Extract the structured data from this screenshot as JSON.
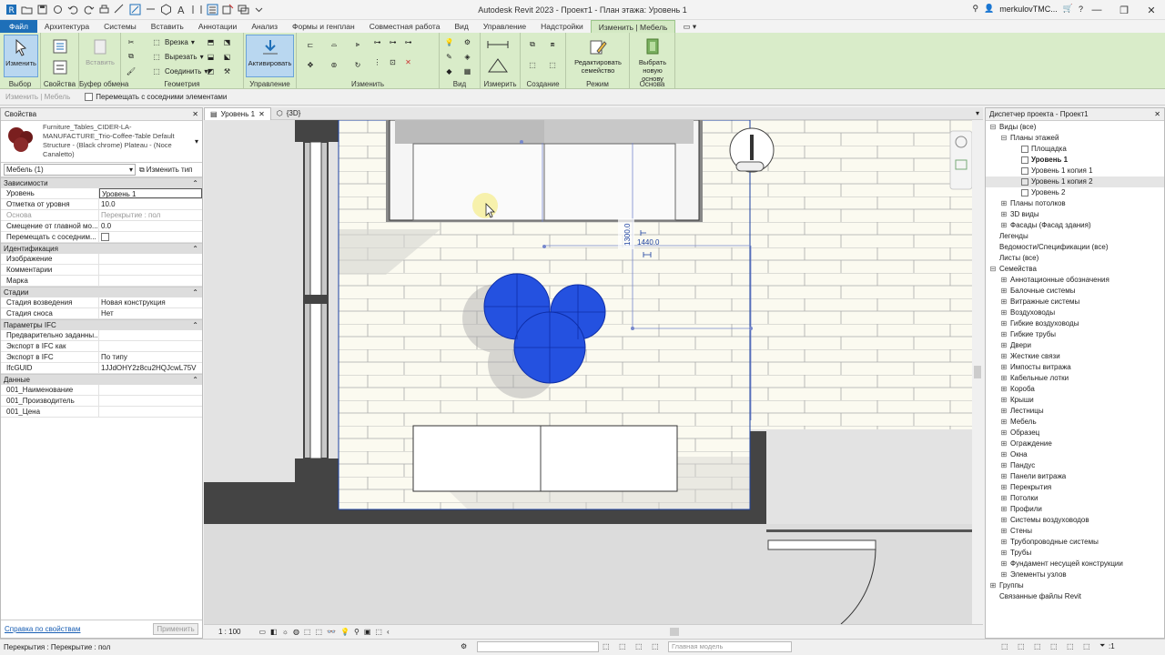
{
  "window": {
    "title": "Autodesk Revit 2023 - Проект1 - План этажа: Уровень 1",
    "user": "merkulovTMC..."
  },
  "ribbon_tabs": [
    "Файл",
    "Архитектура",
    "Системы",
    "Вставить",
    "Аннотации",
    "Анализ",
    "Формы и генплан",
    "Совместная работа",
    "Вид",
    "Управление",
    "Надстройки",
    "Изменить | Мебель"
  ],
  "ribbon": {
    "modify_label": "Изменить",
    "properties_label": "Свойства",
    "paste_label": "Вставить",
    "cut_label": "Врезка",
    "unjoin_label": "Вырезать",
    "join_label": "Соединить",
    "activate_label": "Активировать",
    "edit_family_label": "Редактировать семейство",
    "pick_host_label": "Выбрать новую основу",
    "groups": {
      "select": "Выбор",
      "props": "Свойства",
      "clipboard": "Буфер обмена",
      "geometry": "Геометрия",
      "control": "Управление",
      "modify": "Изменить",
      "view": "Вид",
      "measure": "Измерить",
      "create": "Создание",
      "mode": "Режим",
      "host": "Основа"
    }
  },
  "optbar": {
    "context": "Изменить | Мебель",
    "move_with_nearby": "Перемещать с соседними элементами"
  },
  "properties": {
    "header": "Свойства",
    "type_name": "Furniture_Tables_CIDER-LA-MANUFACTURE_Trio-Coffee-Table Default Structure - (Black chrome) Plateau - (Noce Canaletto)",
    "selector": "Мебель (1)",
    "edit_type": "Изменить тип",
    "sections": [
      {
        "title": "Зависимости",
        "rows": [
          {
            "k": "Уровень",
            "v": "Уровень 1"
          },
          {
            "k": "Отметка от уровня",
            "v": "10.0"
          },
          {
            "k": "Основа",
            "v": "Перекрытие : пол"
          },
          {
            "k": "Смещение от главной мо...",
            "v": "0.0"
          },
          {
            "k": "Перемещать с соседним...",
            "v": ""
          }
        ]
      },
      {
        "title": "Идентификация",
        "rows": [
          {
            "k": "Изображение",
            "v": ""
          },
          {
            "k": "Комментарии",
            "v": ""
          },
          {
            "k": "Марка",
            "v": ""
          }
        ]
      },
      {
        "title": "Стадии",
        "rows": [
          {
            "k": "Стадия возведения",
            "v": "Новая конструкция"
          },
          {
            "k": "Стадия сноса",
            "v": "Нет"
          }
        ]
      },
      {
        "title": "Параметры IFC",
        "rows": [
          {
            "k": "Предварительно заданны...",
            "v": ""
          },
          {
            "k": "Экспорт в IFC как",
            "v": ""
          },
          {
            "k": "Экспорт в IFC",
            "v": "По типу"
          },
          {
            "k": "IfcGUID",
            "v": "1JJdOHY2z8cu2HQJcwL75V"
          }
        ]
      },
      {
        "title": "Данные",
        "rows": [
          {
            "k": "001_Наименование",
            "v": ""
          },
          {
            "k": "001_Производитель",
            "v": ""
          },
          {
            "k": "001_Цена",
            "v": ""
          }
        ]
      }
    ],
    "help_link": "Справка по свойствам",
    "apply": "Применить"
  },
  "view_tabs": [
    {
      "label": "Уровень 1"
    },
    {
      "label": "{3D}"
    }
  ],
  "canvas": {
    "dim_vertical": "1300.0",
    "dim_horizontal": "1440.0"
  },
  "view_control": {
    "scale": "1 : 100"
  },
  "browser": {
    "header": "Диспетчер проекта - Проект1",
    "items": [
      {
        "label": "Виды (все)",
        "level": 0,
        "toggle": "⊟",
        "bold": false
      },
      {
        "label": "Планы этажей",
        "level": 1,
        "toggle": "⊟",
        "bold": false
      },
      {
        "label": "Площадка",
        "level": 2,
        "toggle": "",
        "bold": false
      },
      {
        "label": "Уровень 1",
        "level": 2,
        "toggle": "",
        "bold": true
      },
      {
        "label": "Уровень 1 копия 1",
        "level": 2,
        "toggle": "",
        "bold": false
      },
      {
        "label": "Уровень 1 копия 2",
        "level": 2,
        "toggle": "",
        "bold": false,
        "sel": true
      },
      {
        "label": "Уровень 2",
        "level": 2,
        "toggle": "",
        "bold": false
      },
      {
        "label": "Планы потолков",
        "level": 1,
        "toggle": "⊞",
        "bold": false
      },
      {
        "label": "3D виды",
        "level": 1,
        "toggle": "⊞",
        "bold": false
      },
      {
        "label": "Фасады (Фасад здания)",
        "level": 1,
        "toggle": "⊞",
        "bold": false
      },
      {
        "label": "Легенды",
        "level": 0,
        "toggle": "",
        "bold": false
      },
      {
        "label": "Ведомости/Спецификации (все)",
        "level": 0,
        "toggle": "",
        "bold": false
      },
      {
        "label": "Листы (все)",
        "level": 0,
        "toggle": "",
        "bold": false
      },
      {
        "label": "Семейства",
        "level": 0,
        "toggle": "⊟",
        "bold": false
      },
      {
        "label": "Аннотационные обозначения",
        "level": 1,
        "toggle": "⊞",
        "bold": false
      },
      {
        "label": "Балочные системы",
        "level": 1,
        "toggle": "⊞",
        "bold": false
      },
      {
        "label": "Витражные системы",
        "level": 1,
        "toggle": "⊞",
        "bold": false
      },
      {
        "label": "Воздуховоды",
        "level": 1,
        "toggle": "⊞",
        "bold": false
      },
      {
        "label": "Гибкие воздуховоды",
        "level": 1,
        "toggle": "⊞",
        "bold": false
      },
      {
        "label": "Гибкие трубы",
        "level": 1,
        "toggle": "⊞",
        "bold": false
      },
      {
        "label": "Двери",
        "level": 1,
        "toggle": "⊞",
        "bold": false
      },
      {
        "label": "Жесткие связи",
        "level": 1,
        "toggle": "⊞",
        "bold": false
      },
      {
        "label": "Импосты витража",
        "level": 1,
        "toggle": "⊞",
        "bold": false
      },
      {
        "label": "Кабельные лотки",
        "level": 1,
        "toggle": "⊞",
        "bold": false
      },
      {
        "label": "Короба",
        "level": 1,
        "toggle": "⊞",
        "bold": false
      },
      {
        "label": "Крыши",
        "level": 1,
        "toggle": "⊞",
        "bold": false
      },
      {
        "label": "Лестницы",
        "level": 1,
        "toggle": "⊞",
        "bold": false
      },
      {
        "label": "Мебель",
        "level": 1,
        "toggle": "⊞",
        "bold": false
      },
      {
        "label": "Образец",
        "level": 1,
        "toggle": "⊞",
        "bold": false
      },
      {
        "label": "Ограждение",
        "level": 1,
        "toggle": "⊞",
        "bold": false
      },
      {
        "label": "Окна",
        "level": 1,
        "toggle": "⊞",
        "bold": false
      },
      {
        "label": "Пандус",
        "level": 1,
        "toggle": "⊞",
        "bold": false
      },
      {
        "label": "Панели витража",
        "level": 1,
        "toggle": "⊞",
        "bold": false
      },
      {
        "label": "Перекрытия",
        "level": 1,
        "toggle": "⊞",
        "bold": false
      },
      {
        "label": "Потолки",
        "level": 1,
        "toggle": "⊞",
        "bold": false
      },
      {
        "label": "Профили",
        "level": 1,
        "toggle": "⊞",
        "bold": false
      },
      {
        "label": "Системы воздуховодов",
        "level": 1,
        "toggle": "⊞",
        "bold": false
      },
      {
        "label": "Стены",
        "level": 1,
        "toggle": "⊞",
        "bold": false
      },
      {
        "label": "Трубопроводные системы",
        "level": 1,
        "toggle": "⊞",
        "bold": false
      },
      {
        "label": "Трубы",
        "level": 1,
        "toggle": "⊞",
        "bold": false
      },
      {
        "label": "Фундамент несущей конструкции",
        "level": 1,
        "toggle": "⊞",
        "bold": false
      },
      {
        "label": "Элементы узлов",
        "level": 1,
        "toggle": "⊞",
        "bold": false
      },
      {
        "label": "Группы",
        "level": 0,
        "toggle": "⊞",
        "bold": false
      },
      {
        "label": "Связанные файлы Revit",
        "level": 0,
        "toggle": "",
        "bold": false
      }
    ]
  },
  "status": {
    "text": "Перекрытия : Перекрытие : пол",
    "model": "Главная модель",
    "filter_count": ":1"
  },
  "colors": {
    "accent": "#1e6fb8",
    "ribbon_bg": "#d9ecc9",
    "selection": "#1a4fd8"
  }
}
